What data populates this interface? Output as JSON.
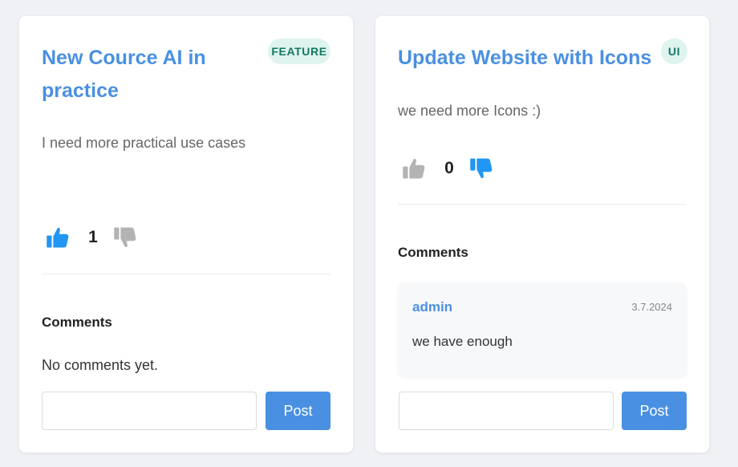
{
  "colors": {
    "accent": "#4a90e2",
    "vote_active": "#2196f3",
    "vote_inactive": "#b3b3b3",
    "badge_bg": "#dff4ef",
    "badge_text": "#137a62"
  },
  "cards": [
    {
      "title": "New Cource AI in practice",
      "badge": "FEATURE",
      "description": "I need more practical use cases",
      "vote_count": "1",
      "upvote_icon": "thumbs-up-icon",
      "downvote_icon": "thumbs-down-icon",
      "voted": "up",
      "comments_heading": "Comments",
      "no_comments_text": "No comments yet.",
      "comment_input_value": "",
      "post_label": "Post"
    },
    {
      "title": "Update Website with Icons",
      "badge": "UI",
      "description": "we need more Icons :)",
      "vote_count": "0",
      "upvote_icon": "thumbs-up-icon",
      "downvote_icon": "thumbs-down-icon",
      "voted": "down",
      "comments_heading": "Comments",
      "comments": [
        {
          "author": "admin",
          "date": "3.7.2024",
          "text": "we have enough"
        }
      ],
      "comment_input_value": "",
      "post_label": "Post"
    }
  ]
}
